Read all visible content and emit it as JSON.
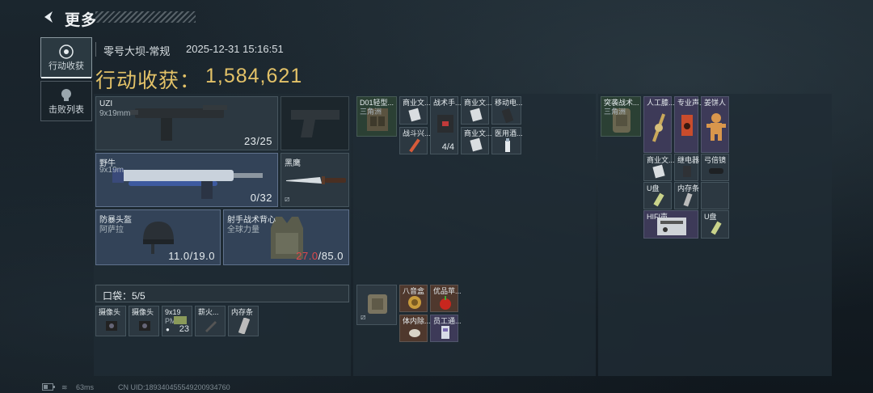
{
  "header": {
    "title": "更多"
  },
  "nav": {
    "loot_tab": "行动收获",
    "kills_tab": "击败列表"
  },
  "info": {
    "map_mode": "零号大坝-常规",
    "timestamp": "2025-12-31 15:16:51"
  },
  "loot": {
    "label": "行动收获：",
    "value": "1,584,621"
  },
  "equipment": {
    "primary": {
      "name": "UZI",
      "caliber": "9x19mm",
      "ammo": "23/25"
    },
    "secondary": {
      "name": "野牛",
      "caliber": "9x19m",
      "ammo": "0/32"
    },
    "melee": {
      "name": "黑鹰"
    },
    "helmet": {
      "name": "防暴头盔",
      "brand": "阿萨拉",
      "durability": "11.0/19.0"
    },
    "armor": {
      "name": "射手战术背心",
      "brand": "全球力量",
      "durability_current": "27.0",
      "durability_max": "/85.0"
    }
  },
  "pocket": {
    "label": "口袋：5/5",
    "items": [
      {
        "name": "摄像头"
      },
      {
        "name": "摄像头"
      },
      {
        "name": "9x19",
        "sub": "PM",
        "count": "23"
      },
      {
        "name": "薪火..."
      },
      {
        "name": "内存条"
      }
    ]
  },
  "chest_rig": {
    "name": "D01轻型...",
    "sub": "三角洲"
  },
  "chest_items": [
    {
      "name": "商业文..."
    },
    {
      "name": "战术手...",
      "count": "4/4"
    },
    {
      "name": "商业文..."
    },
    {
      "name": "移动电..."
    },
    {
      "name": "战斗兴..."
    },
    {
      "name": "商业文..."
    },
    {
      "name": "医用酒..."
    }
  ],
  "pouch_items": [
    {
      "name": "八音盒"
    },
    {
      "name": "优品苹..."
    },
    {
      "name": "体内除..."
    },
    {
      "name": "员工通..."
    }
  ],
  "backpack": {
    "name": "突袭战术...",
    "sub": "三角洲"
  },
  "backpack_items": [
    {
      "name": "人工膝..."
    },
    {
      "name": "专业声..."
    },
    {
      "name": "姜饼人"
    },
    {
      "name": "商业文..."
    },
    {
      "name": "继电器"
    },
    {
      "name": "弓倍镜"
    },
    {
      "name": "U盘"
    },
    {
      "name": "内存条"
    },
    {
      "name": "HIFI声..."
    },
    {
      "name": "U盘"
    }
  ],
  "footer": {
    "latency": "63ms",
    "uid": "CN UID:1893404555492009347​60"
  },
  "colors": {
    "gold": "#e3c268",
    "danger": "#e0494c"
  }
}
